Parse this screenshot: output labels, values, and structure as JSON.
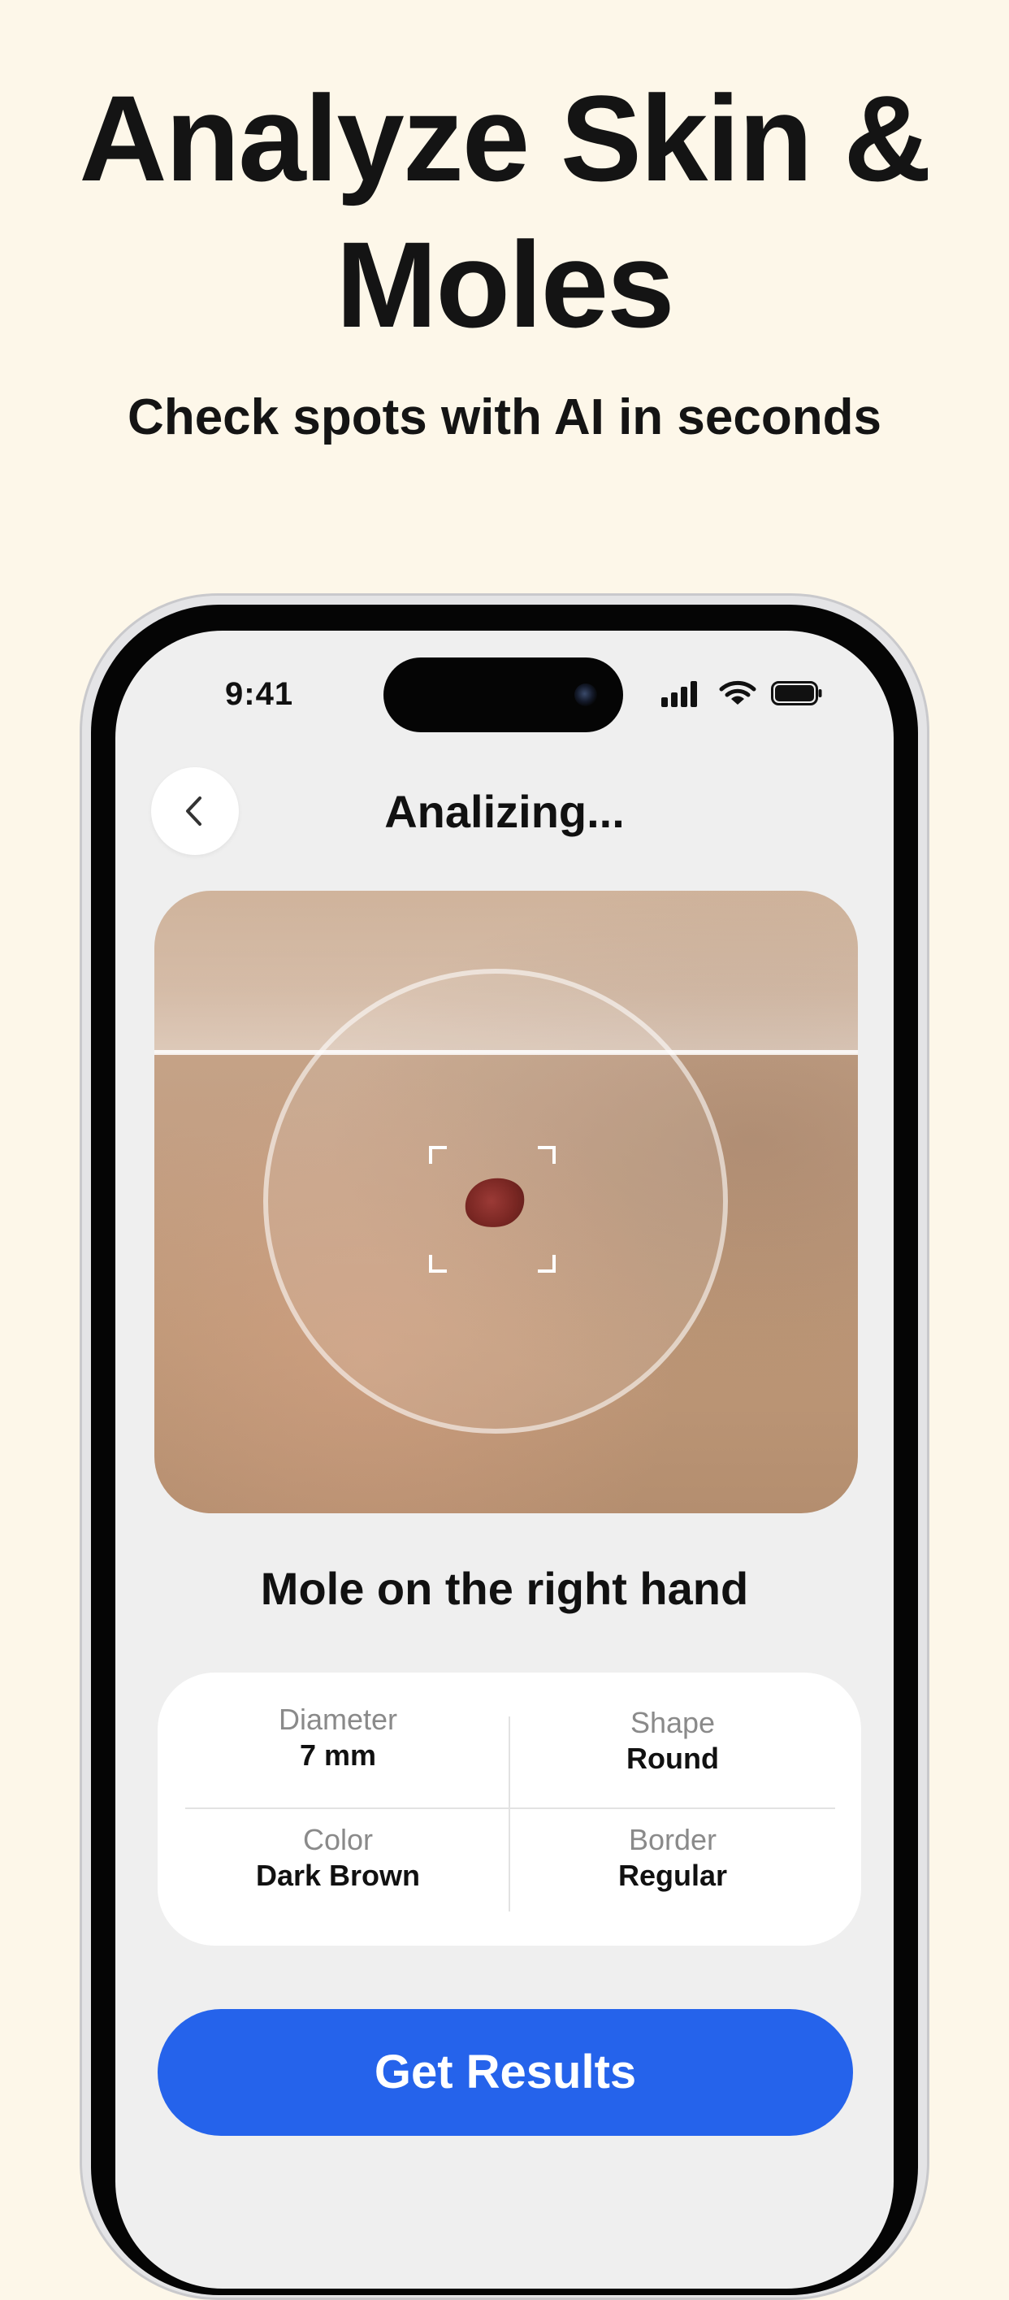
{
  "marketing": {
    "headline_line1": "Analyze Skin &",
    "headline_line2": "Moles",
    "subheadline": "Check spots with AI in seconds"
  },
  "status_bar": {
    "time": "9:41",
    "icons": [
      "signal-icon",
      "wifi-icon",
      "battery-icon"
    ]
  },
  "screen": {
    "title": "Analizing...",
    "back_icon": "chevron-left-icon",
    "image_alt": "skin close-up with mole",
    "mole_title": "Mole on the right hand"
  },
  "details": {
    "diameter": {
      "label": "Diameter",
      "value": "7 mm"
    },
    "shape": {
      "label": "Shape",
      "value": "Round"
    },
    "color": {
      "label": "Color",
      "value": "Dark Brown"
    },
    "border": {
      "label": "Border",
      "value": "Regular"
    }
  },
  "actions": {
    "get_results_label": "Get Results"
  },
  "colors": {
    "background": "#FDF7E9",
    "screen_background": "#EFEFEF",
    "accent": "#2563EB",
    "mole": "#7A2723"
  }
}
